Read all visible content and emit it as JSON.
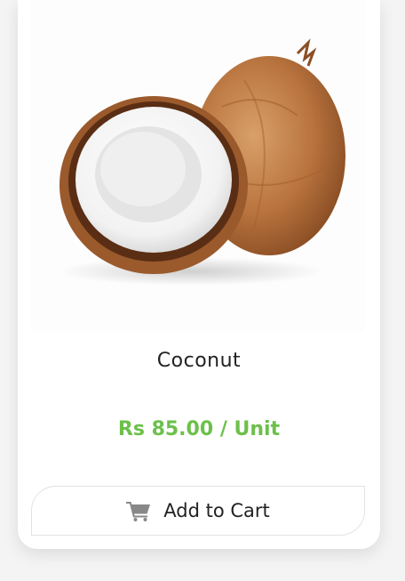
{
  "product": {
    "name": "Coconut",
    "price": "Rs 85.00 / Unit",
    "add_to_cart_label": "Add to Cart",
    "cart_icon": "shopping-cart-icon"
  },
  "colors": {
    "price": "#6cc04a",
    "card_background": "#ffffff",
    "page_background": "#f4f4f4"
  }
}
